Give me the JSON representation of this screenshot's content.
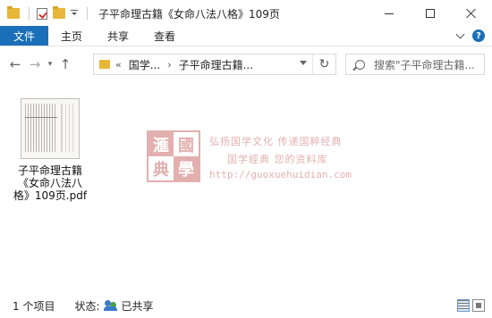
{
  "window": {
    "title": "子平命理古籍《女命八法八格》109页"
  },
  "ribbon": {
    "tabs": [
      "文件",
      "主页",
      "共享",
      "查看"
    ]
  },
  "nav": {
    "address_overflow": "«",
    "breadcrumbs": [
      "国学...",
      "子平命理古籍..."
    ],
    "search_placeholder": "搜索\"子平命理古籍...",
    "refresh_glyph": "↻"
  },
  "content": {
    "files": [
      {
        "name": "子平命理古籍《女命八法八格》109页.pdf",
        "icon": "pdf-thumbnail"
      }
    ]
  },
  "watermark": {
    "seal_chars": [
      "滙",
      "國",
      "典",
      "學"
    ],
    "line1": "弘扬国学文化  传递国粹经典",
    "line2": "国学經典 您的资料库",
    "url": "http://guoxuehuidian.com"
  },
  "status": {
    "item_count": "1 个项目",
    "state_label": "状态:",
    "state_value": "已共享"
  }
}
